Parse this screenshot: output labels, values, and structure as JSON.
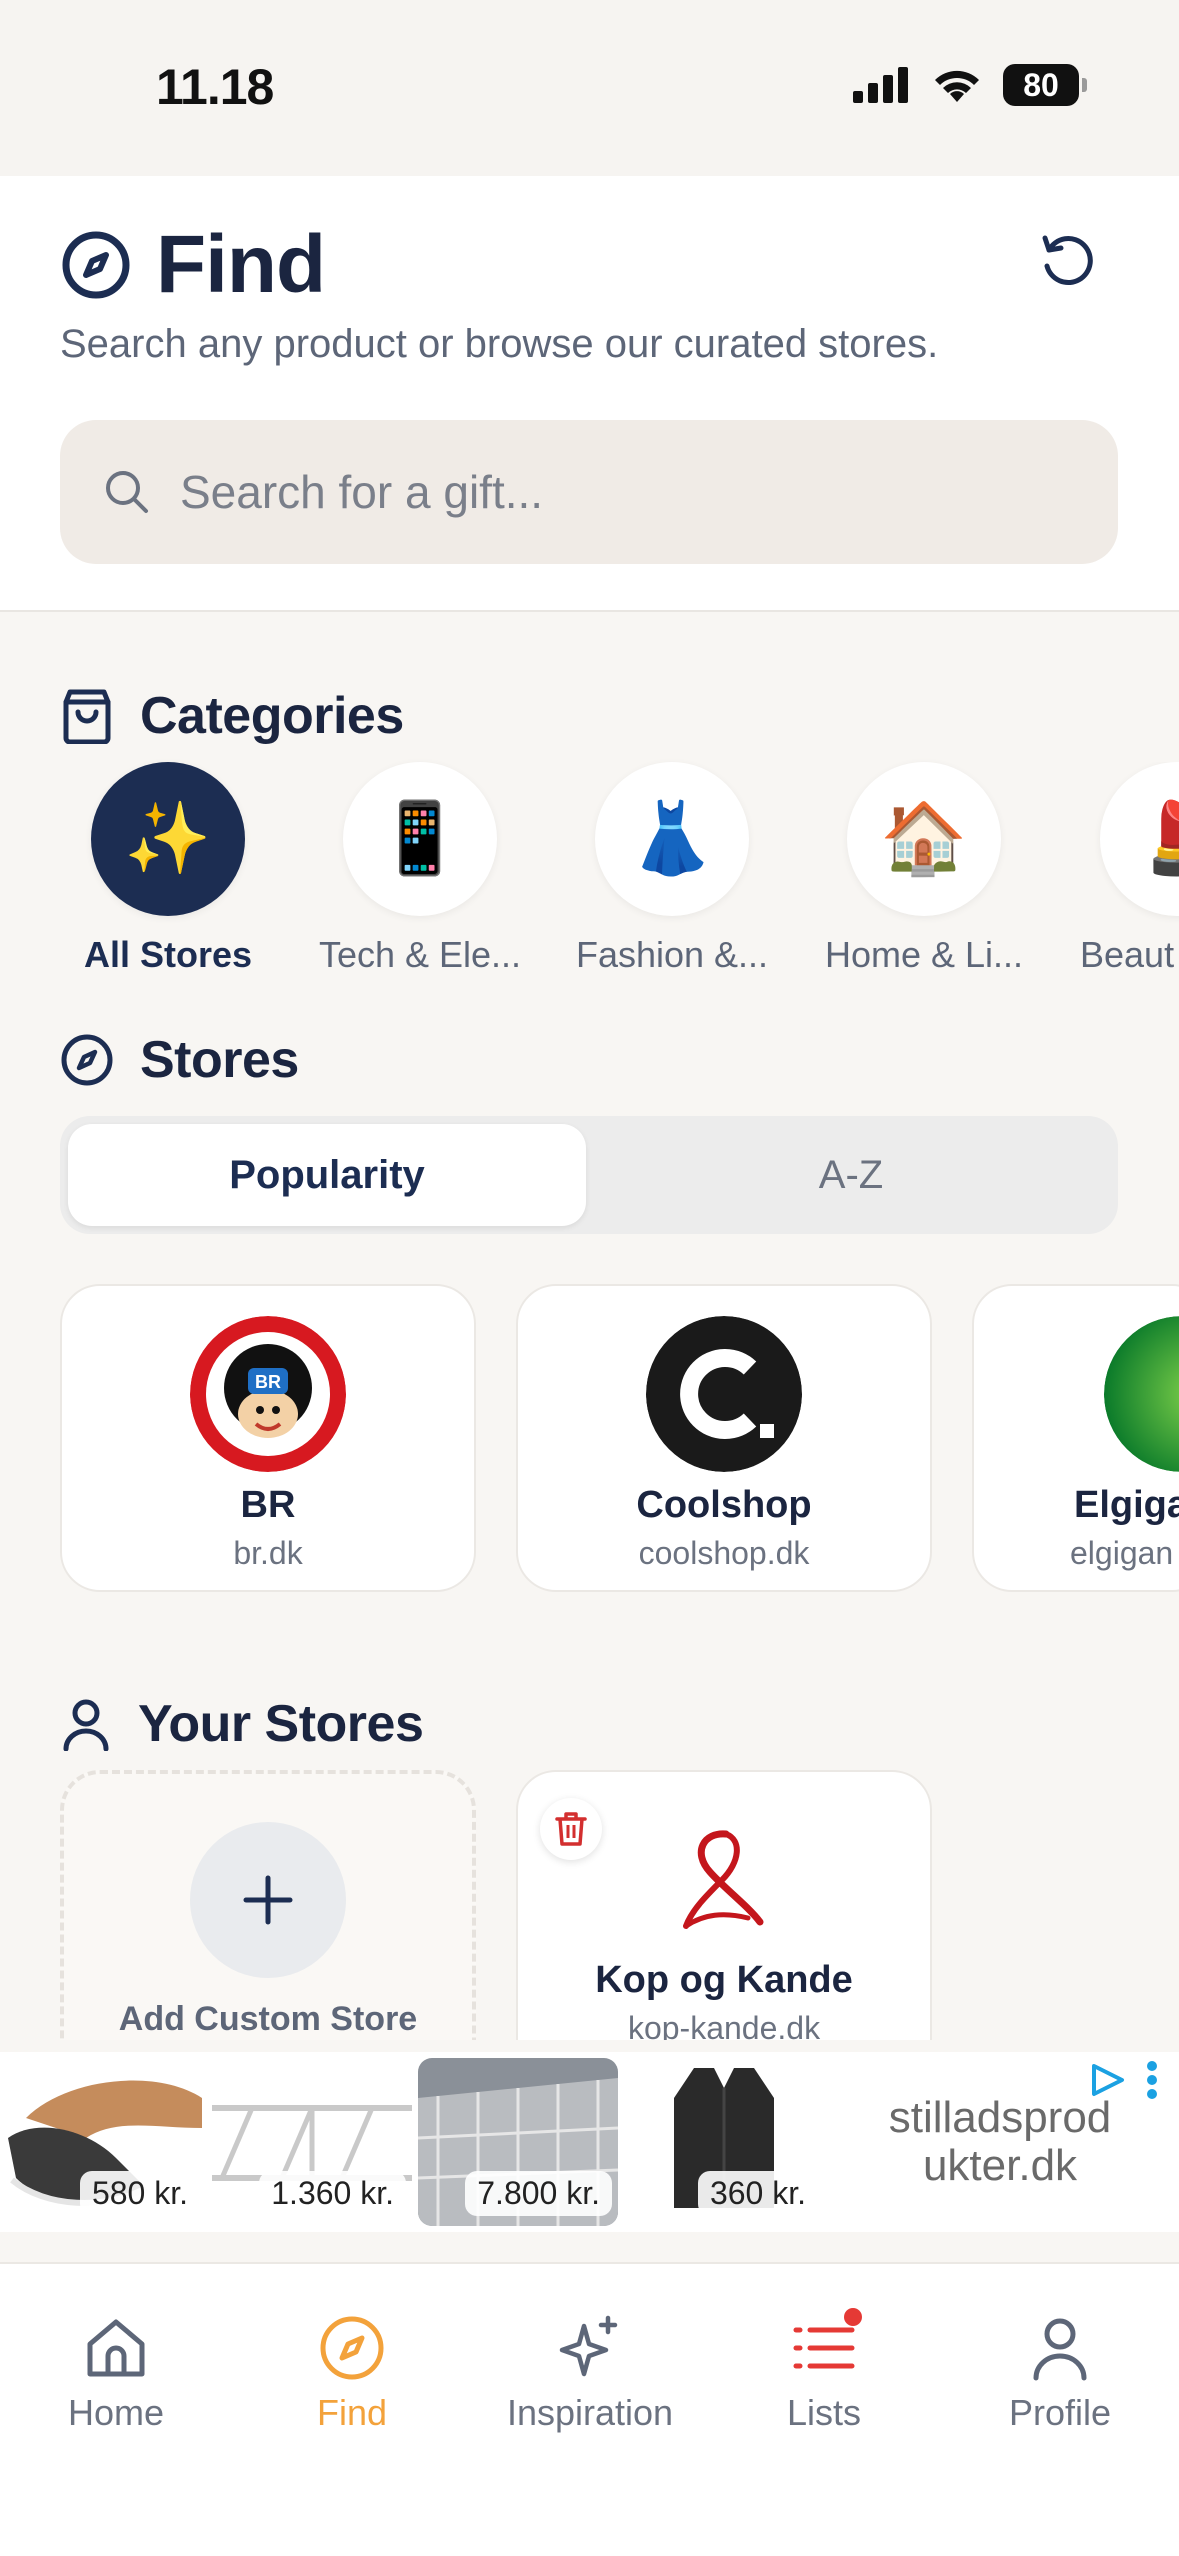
{
  "status_bar": {
    "time": "11.18",
    "battery": "80"
  },
  "header": {
    "title": "Find",
    "subtitle": "Search any product or browse our curated stores.",
    "search_placeholder": "Search for a gift..."
  },
  "categories": {
    "title": "Categories",
    "items": [
      {
        "label": "All Stores",
        "emoji": "✨",
        "icon": "sparkles-icon"
      },
      {
        "label": "Tech & Ele...",
        "emoji": "📱",
        "icon": "phone-icon"
      },
      {
        "label": "Fashion &...",
        "emoji": "👗",
        "icon": "dress-icon"
      },
      {
        "label": "Home & Li...",
        "emoji": "🏠",
        "icon": "house-icon"
      },
      {
        "label": "Beaut",
        "emoji": "💄",
        "icon": "lipstick-icon"
      }
    ]
  },
  "stores": {
    "title": "Stores",
    "sort": {
      "popularity": "Popularity",
      "az": "A-Z",
      "selected": "Popularity"
    },
    "items": [
      {
        "name": "BR",
        "url": "br.dk"
      },
      {
        "name": "Coolshop",
        "url": "coolshop.dk"
      },
      {
        "name": "Elgiga",
        "url": "elgigan"
      }
    ]
  },
  "your_stores": {
    "title": "Your Stores",
    "add_label": "Add Custom Store",
    "items": [
      {
        "name": "Kop og Kande",
        "url": "kop-kande.dk"
      }
    ]
  },
  "ad": {
    "brand": "stilladsprod ukter.dk",
    "prices": [
      "580 kr.",
      "1.360 kr.",
      "7.800 kr.",
      "360 kr."
    ]
  },
  "tabbar": {
    "items": [
      {
        "label": "Home",
        "icon": "home-icon"
      },
      {
        "label": "Find",
        "icon": "compass-icon"
      },
      {
        "label": "Inspiration",
        "icon": "sparkle-icon"
      },
      {
        "label": "Lists",
        "icon": "list-icon"
      },
      {
        "label": "Profile",
        "icon": "person-icon"
      }
    ],
    "active": "Find"
  },
  "colors": {
    "navy": "#1c2d52",
    "accent": "#f3a23b",
    "alert": "#e53935"
  }
}
